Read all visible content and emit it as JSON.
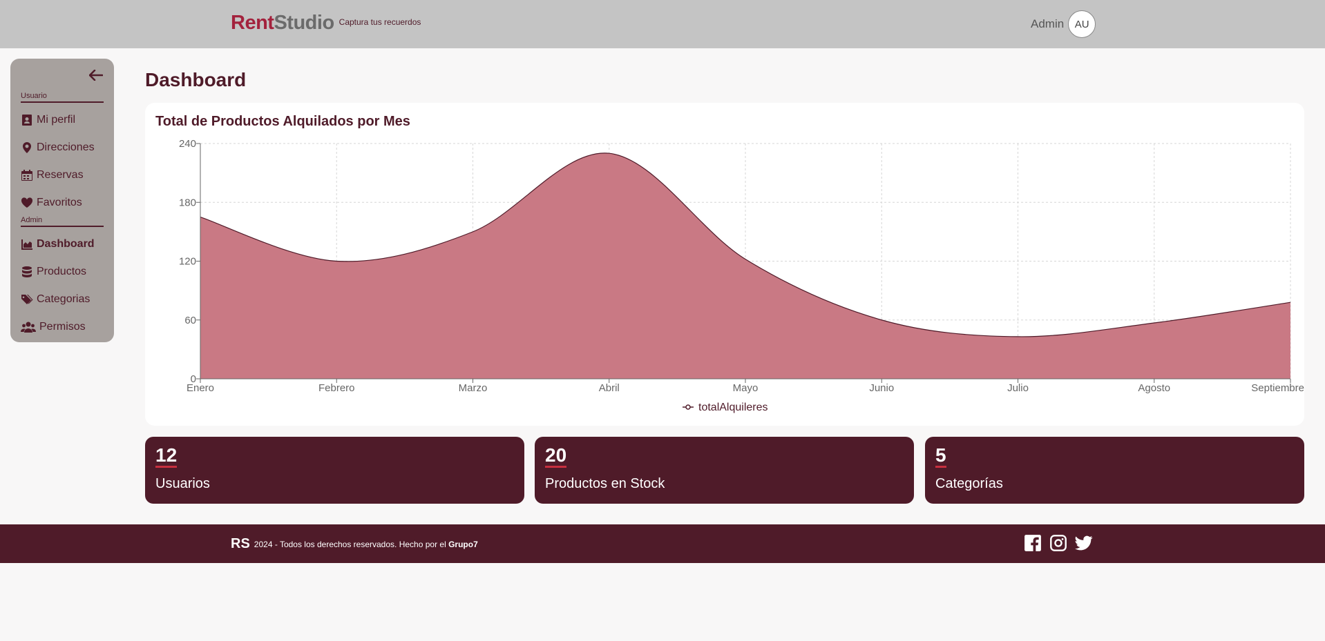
{
  "header": {
    "logo_part1": "Rent",
    "logo_part2": "Studio",
    "tagline": "Captura tus recuerdos",
    "user_name": "Admin",
    "avatar_initials": "AU"
  },
  "sidebar": {
    "user_section": "Usuario",
    "admin_section": "Admin",
    "user_items": [
      {
        "label": "Mi perfil",
        "icon": "id-card-icon"
      },
      {
        "label": "Direcciones",
        "icon": "map-pin-icon"
      },
      {
        "label": "Reservas",
        "icon": "calendar-icon"
      },
      {
        "label": "Favoritos",
        "icon": "heart-icon"
      }
    ],
    "admin_items": [
      {
        "label": "Dashboard",
        "icon": "chart-area-icon",
        "active": true
      },
      {
        "label": "Productos",
        "icon": "database-icon"
      },
      {
        "label": "Categorias",
        "icon": "tags-icon"
      },
      {
        "label": "Permisos",
        "icon": "users-icon"
      }
    ]
  },
  "main": {
    "title": "Dashboard",
    "chart_title": "Total de Productos Alquilados por Mes"
  },
  "chart_data": {
    "type": "area",
    "title": "Total de Productos Alquilados por Mes",
    "categories": [
      "Enero",
      "Febrero",
      "Marzo",
      "Abril",
      "Mayo",
      "Junio",
      "Julio",
      "Agosto",
      "Septiembre"
    ],
    "series": [
      {
        "name": "totalAlquileres",
        "values": [
          165,
          120,
          150,
          230,
          122,
          60,
          43,
          57,
          78
        ]
      }
    ],
    "yticks": [
      0,
      60,
      120,
      180,
      240
    ],
    "ylim": [
      0,
      240
    ],
    "grid": true,
    "legend": "bottom",
    "fill_color": "#c97984",
    "line_color": "#4f1b29"
  },
  "stats": [
    {
      "value": "12",
      "label": "Usuarios"
    },
    {
      "value": "20",
      "label": "Productos en Stock"
    },
    {
      "value": "5",
      "label": "Categorías"
    }
  ],
  "footer": {
    "logo": "RS",
    "text": "2024 - Todos los derechos reservados. Hecho por el",
    "group": "Grupo7",
    "socials": [
      "facebook-icon",
      "instagram-icon",
      "twitter-icon"
    ]
  },
  "colors": {
    "primary": "#4f1b29",
    "accent": "#a3223d",
    "sidebar_bg": "#a7a19e",
    "header_bg": "#c4c4c4"
  }
}
